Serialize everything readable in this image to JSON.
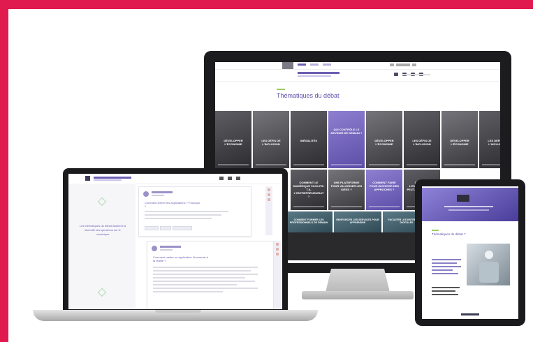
{
  "desktop": {
    "page_title": "Thématiques du débat",
    "tiles_row1": [
      "DÉVELOPPER L'ÉCONOMIE",
      "LES DÉFIS DE L'INCLUSION",
      "INÉGALITÉS",
      "QUI CONTRÔLE LE DEVENIR DE DEMAIN ?",
      "DÉVELOPPER L'ÉCONOMIE",
      "LES DÉFIS DE L'INCLUSION",
      "DÉVELOPPER L'ÉCONOMIE",
      "LES DÉFIS DE L'INCLUSION"
    ],
    "tiles_row2": [
      "COMMENT LE NUMÉRIQUE FACILITE-T-IL L'ENTREPRENEURIAT ?",
      "UNE PLATEFORME POUR VALORISER LES IDÉES ?",
      "COMMENT FAIRE POUR INVENTER DES APPROCHES ?",
      "COMMENT L'ENTREPRENEUR PEUT-IL SE LANCER ?"
    ],
    "tiles_row3": [
      "COMMENT FORMER LES PROFESSIONNELS DE DEMAIN",
      "RENFORCER LES SERVICES POUR APPRENDRE",
      "FACILITER LES ENTREPRISES DIGITALES"
    ]
  },
  "laptop": {
    "quote": "Les thématiques du débat illustrent la diversité des questions sur le numérique",
    "post1_title": "Comment former les applications ? Pourquoi ?",
    "post2_title": "Comment mettre en application l'économie à la réalité ?"
  },
  "tablet": {
    "section_title": "Thématiques du débat ?"
  }
}
